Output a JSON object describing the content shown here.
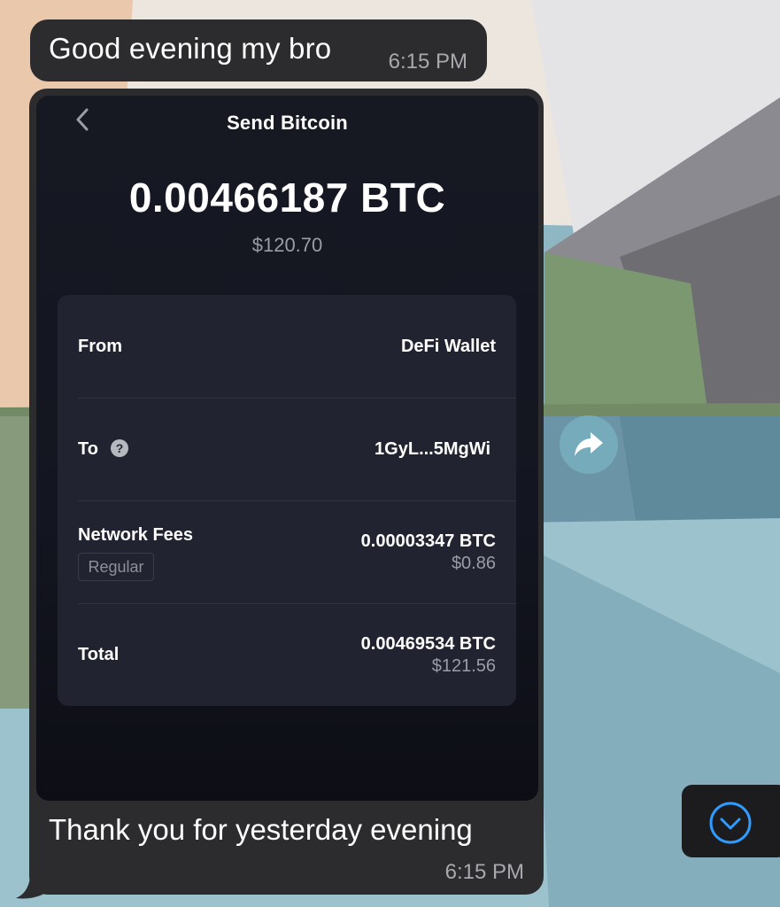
{
  "chat": {
    "messages": [
      {
        "text": "Good evening my bro",
        "time": "6:15 PM"
      },
      {
        "caption": "Thank you for yesterday evening",
        "time": "6:15 PM"
      }
    ]
  },
  "screenshot": {
    "title": "Send Bitcoin",
    "amount": "0.00466187 BTC",
    "amount_fiat": "$120.70",
    "rows": [
      {
        "label": "From",
        "value": "DeFi Wallet"
      },
      {
        "label": "To",
        "value": "1GyL...5MgWi",
        "help_icon": "?"
      },
      {
        "label": "Network Fees",
        "chip": "Regular",
        "value": "0.00003347 BTC",
        "sub": "$0.86"
      },
      {
        "label": "Total",
        "value": "0.00469534 BTC",
        "sub": "$121.56"
      }
    ]
  },
  "icons": {
    "back": "chevron-left-icon",
    "forward": "share-arrow-icon",
    "scroll_down": "chevron-down-circle-icon"
  },
  "colors": {
    "bubble": "#2c2c2e",
    "card": "#212430",
    "accent_blue": "#2f9bff"
  }
}
